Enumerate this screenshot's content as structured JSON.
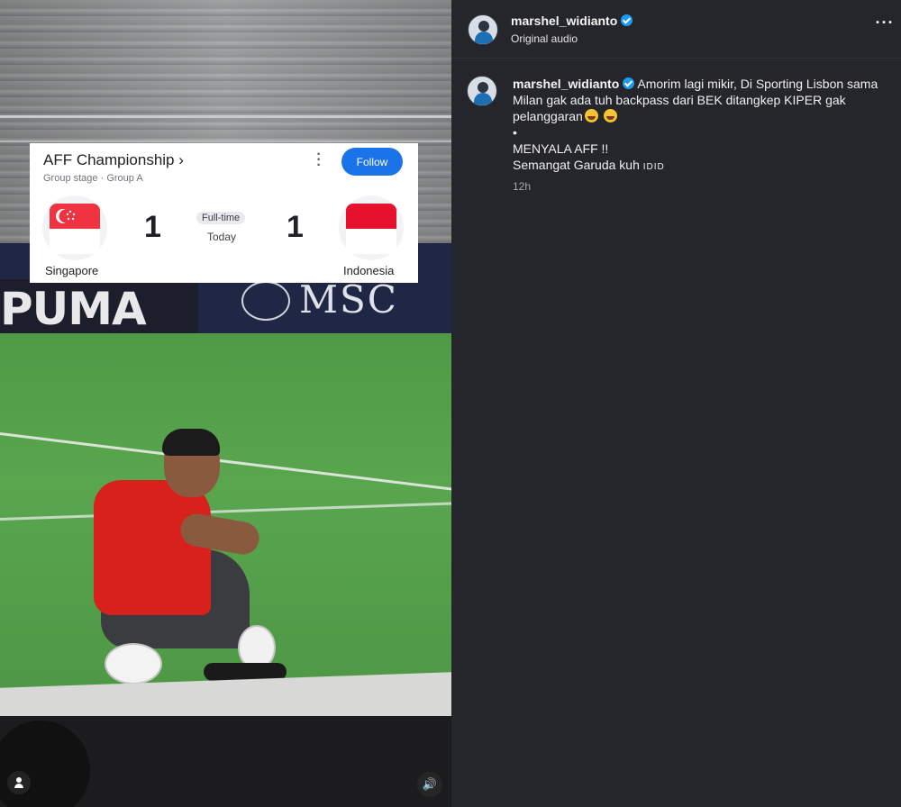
{
  "post": {
    "username": "marshel_widianto",
    "audio": "Original audio",
    "verified": true,
    "caption_part1": "Amorim lagi mikir, Di Sporting Lisbon sama Milan gak ada tuh backpass dari BEK ditangkep KIPER gak pelanggaran",
    "caption_bullet": "•",
    "caption_line2": "MENYALA AFF !!",
    "caption_line3": "Semangat Garuda kuh",
    "caption_flag_text": "IDID",
    "timestamp": "12h",
    "emoji_icons": [
      "rolling-on-floor-laughing-emoji",
      "rolling-on-floor-laughing-emoji"
    ]
  },
  "media_overlay": {
    "card": {
      "title": "AFF Championship",
      "title_chevron": "›",
      "subtitle": "Group stage · Group A",
      "follow_label": "Follow",
      "home_team": "Singapore",
      "away_team": "Indonesia",
      "home_score": "1",
      "away_score": "1",
      "status": "Full-time",
      "date": "Today"
    },
    "signage": {
      "left_brand": "PUMA",
      "right_brand": "MSC",
      "emblem_text": "MSC"
    }
  },
  "colors": {
    "follow_button": "#1a73e8",
    "singapore_red": "#ef3340",
    "indonesia_red": "#e8112d",
    "verified_blue": "#1d9bf0",
    "panel_bg": "#25262b"
  }
}
